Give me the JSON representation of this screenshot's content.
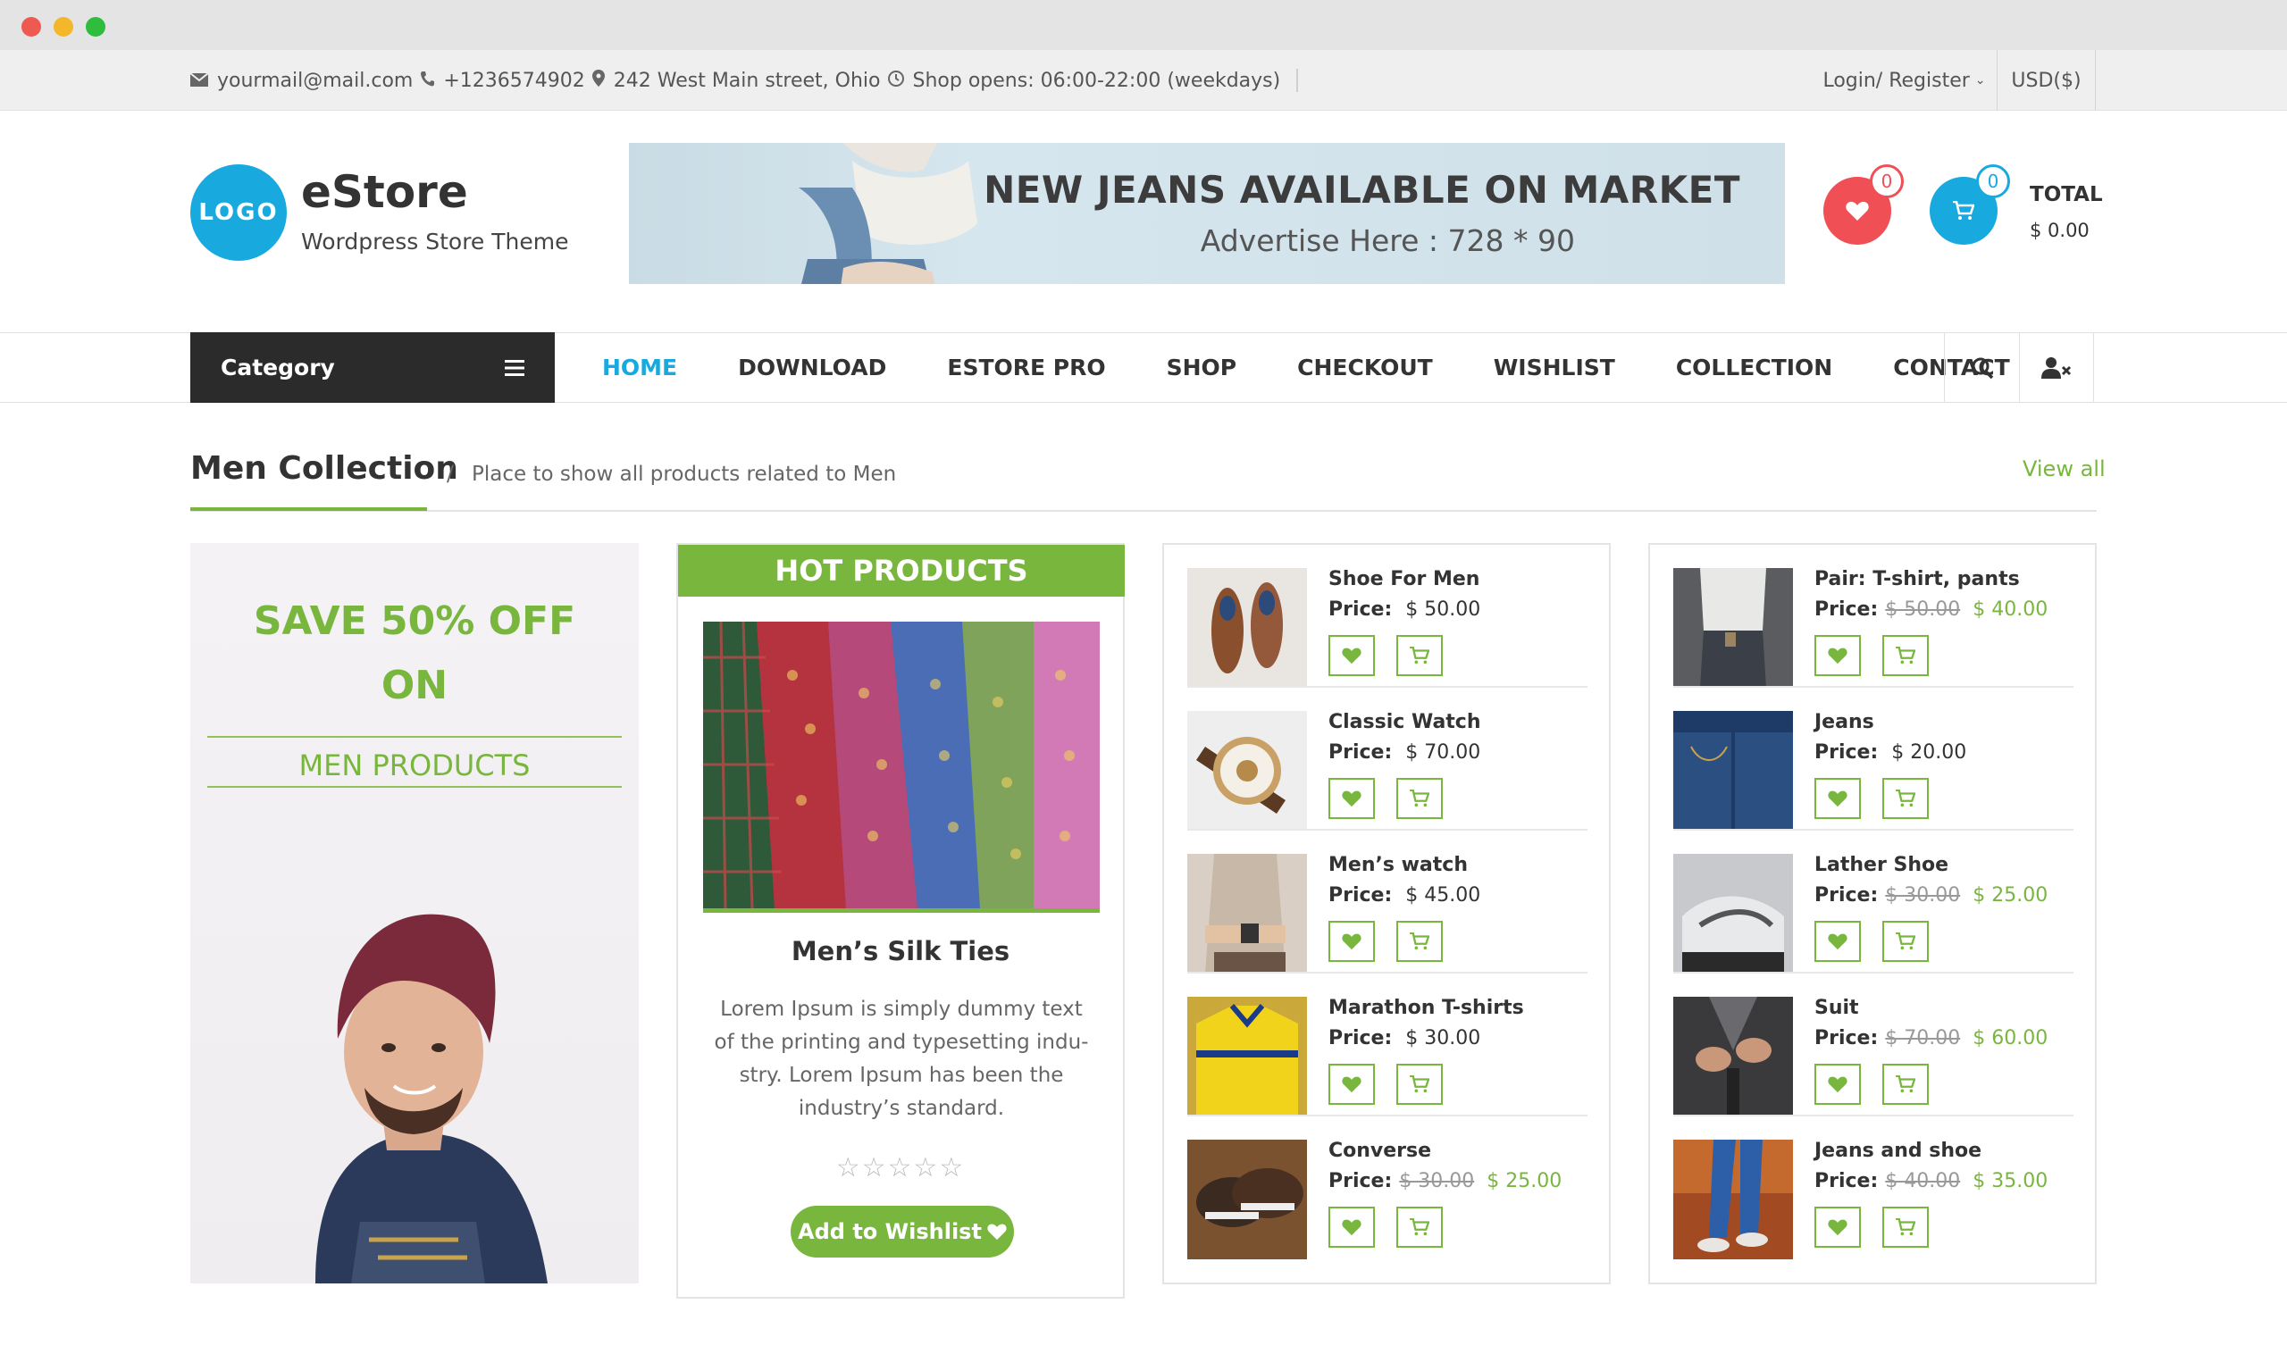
{
  "topbar": {
    "email": "yourmail@mail.com",
    "phone": "+1236574902",
    "address": "242 West Main street, Ohio",
    "hours": "Shop opens: 06:00-22:00 (weekdays)",
    "login": "Login/ Register",
    "currency": "USD($)"
  },
  "header": {
    "logo_text": "LOGO",
    "site_title": "eStore",
    "tagline": "Wordpress Store Theme",
    "banner_headline": "NEW JEANS AVAILABLE ON MARKET",
    "banner_sub": "Advertise Here : 728 * 90",
    "wishlist_count": "0",
    "cart_count": "0",
    "total_label": "TOTAL",
    "total_value": "$ 0.00"
  },
  "nav": {
    "category": "Category",
    "items": [
      "HOME",
      "DOWNLOAD",
      "ESTORE PRO",
      "SHOP",
      "CHECKOUT",
      "WISHLIST",
      "COLLECTION",
      "CONTACT"
    ],
    "active": "HOME"
  },
  "section": {
    "title": "Men Collection",
    "slash": "/",
    "subtitle": "Place to show all products related to Men",
    "view_all": "View all"
  },
  "promo": {
    "line1": "SAVE 50% OFF",
    "line2": "ON",
    "line3": "MEN PRODUCTS"
  },
  "hot": {
    "heading": "HOT PRODUCTS",
    "title": "Men’s Silk Ties",
    "description": "Lorem Ipsum is simply dummy text of the printing and typesetting indu-stry. Lorem Ipsum has been the industry’s standard.",
    "stars": "☆☆☆☆☆",
    "rating": 0,
    "cta": "Add to Wishlist"
  },
  "price_label": "Price:",
  "products_a": [
    {
      "name": "Shoe For Men",
      "price": "$ 50.00",
      "thumb": "shoe-image"
    },
    {
      "name": "Classic Watch",
      "price": "$ 70.00",
      "thumb": "watch-image"
    },
    {
      "name": "Men’s watch",
      "price": "$ 45.00",
      "thumb": "mens-watch-image"
    },
    {
      "name": "Marathon T-shirts",
      "price": "$ 30.00",
      "thumb": "tshirt-image"
    },
    {
      "name": "Converse",
      "old_price": "$ 30.00",
      "price": "$ 25.00",
      "thumb": "converse-image"
    }
  ],
  "products_b": [
    {
      "name": "Pair: T-shirt, pants",
      "old_price": "$ 50.00",
      "price": "$ 40.00",
      "thumb": "tshirt-pants-image"
    },
    {
      "name": "Jeans",
      "price": "$ 20.00",
      "thumb": "jeans-image"
    },
    {
      "name": "Lather Shoe",
      "old_price": "$ 30.00",
      "price": "$ 25.00",
      "thumb": "leather-shoe-image"
    },
    {
      "name": "Suit",
      "old_price": "$ 70.00",
      "price": "$ 60.00",
      "thumb": "suit-image"
    },
    {
      "name": "Jeans and shoe",
      "old_price": "$ 40.00",
      "price": "$ 35.00",
      "thumb": "jeans-shoe-image"
    }
  ],
  "colors": {
    "accent_green": "#79b63e",
    "accent_blue": "#18a9df",
    "wishlist_red": "#ef4f55",
    "dark": "#2b2b2b"
  }
}
